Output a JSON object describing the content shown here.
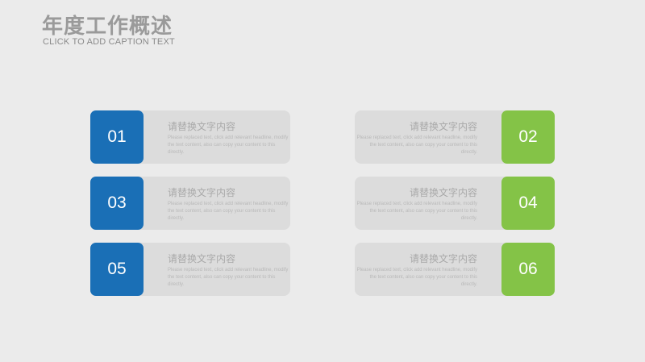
{
  "header": {
    "title": "年度工作概述",
    "subtitle": "CLICK TO ADD CAPTION TEXT"
  },
  "colors": {
    "left_accent": "#1a6fb6",
    "right_accent": "#84c347",
    "panel": "#dcdcdc"
  },
  "cards": [
    {
      "number": "01",
      "heading": "请替换文字内容",
      "desc": "Please replaced text, click add relevant headline, modify the text content, also can copy your content to this directly."
    },
    {
      "number": "02",
      "heading": "请替换文字内容",
      "desc": "Please replaced text, click add relevant headline, modify the text content, also can copy your content to this directly."
    },
    {
      "number": "03",
      "heading": "请替换文字内容",
      "desc": "Please replaced text, click add relevant headline, modify the text content, also can copy your content to this directly."
    },
    {
      "number": "04",
      "heading": "请替换文字内容",
      "desc": "Please replaced text, click add relevant headline, modify the text content, also can copy your content to this directly."
    },
    {
      "number": "05",
      "heading": "请替换文字内容",
      "desc": "Please replaced text, click add relevant headline, modify the text content, also can copy your content to this directly."
    },
    {
      "number": "06",
      "heading": "请替换文字内容",
      "desc": "Please replaced text, click add relevant headline, modify the text content, also can copy your content to this directly."
    }
  ]
}
